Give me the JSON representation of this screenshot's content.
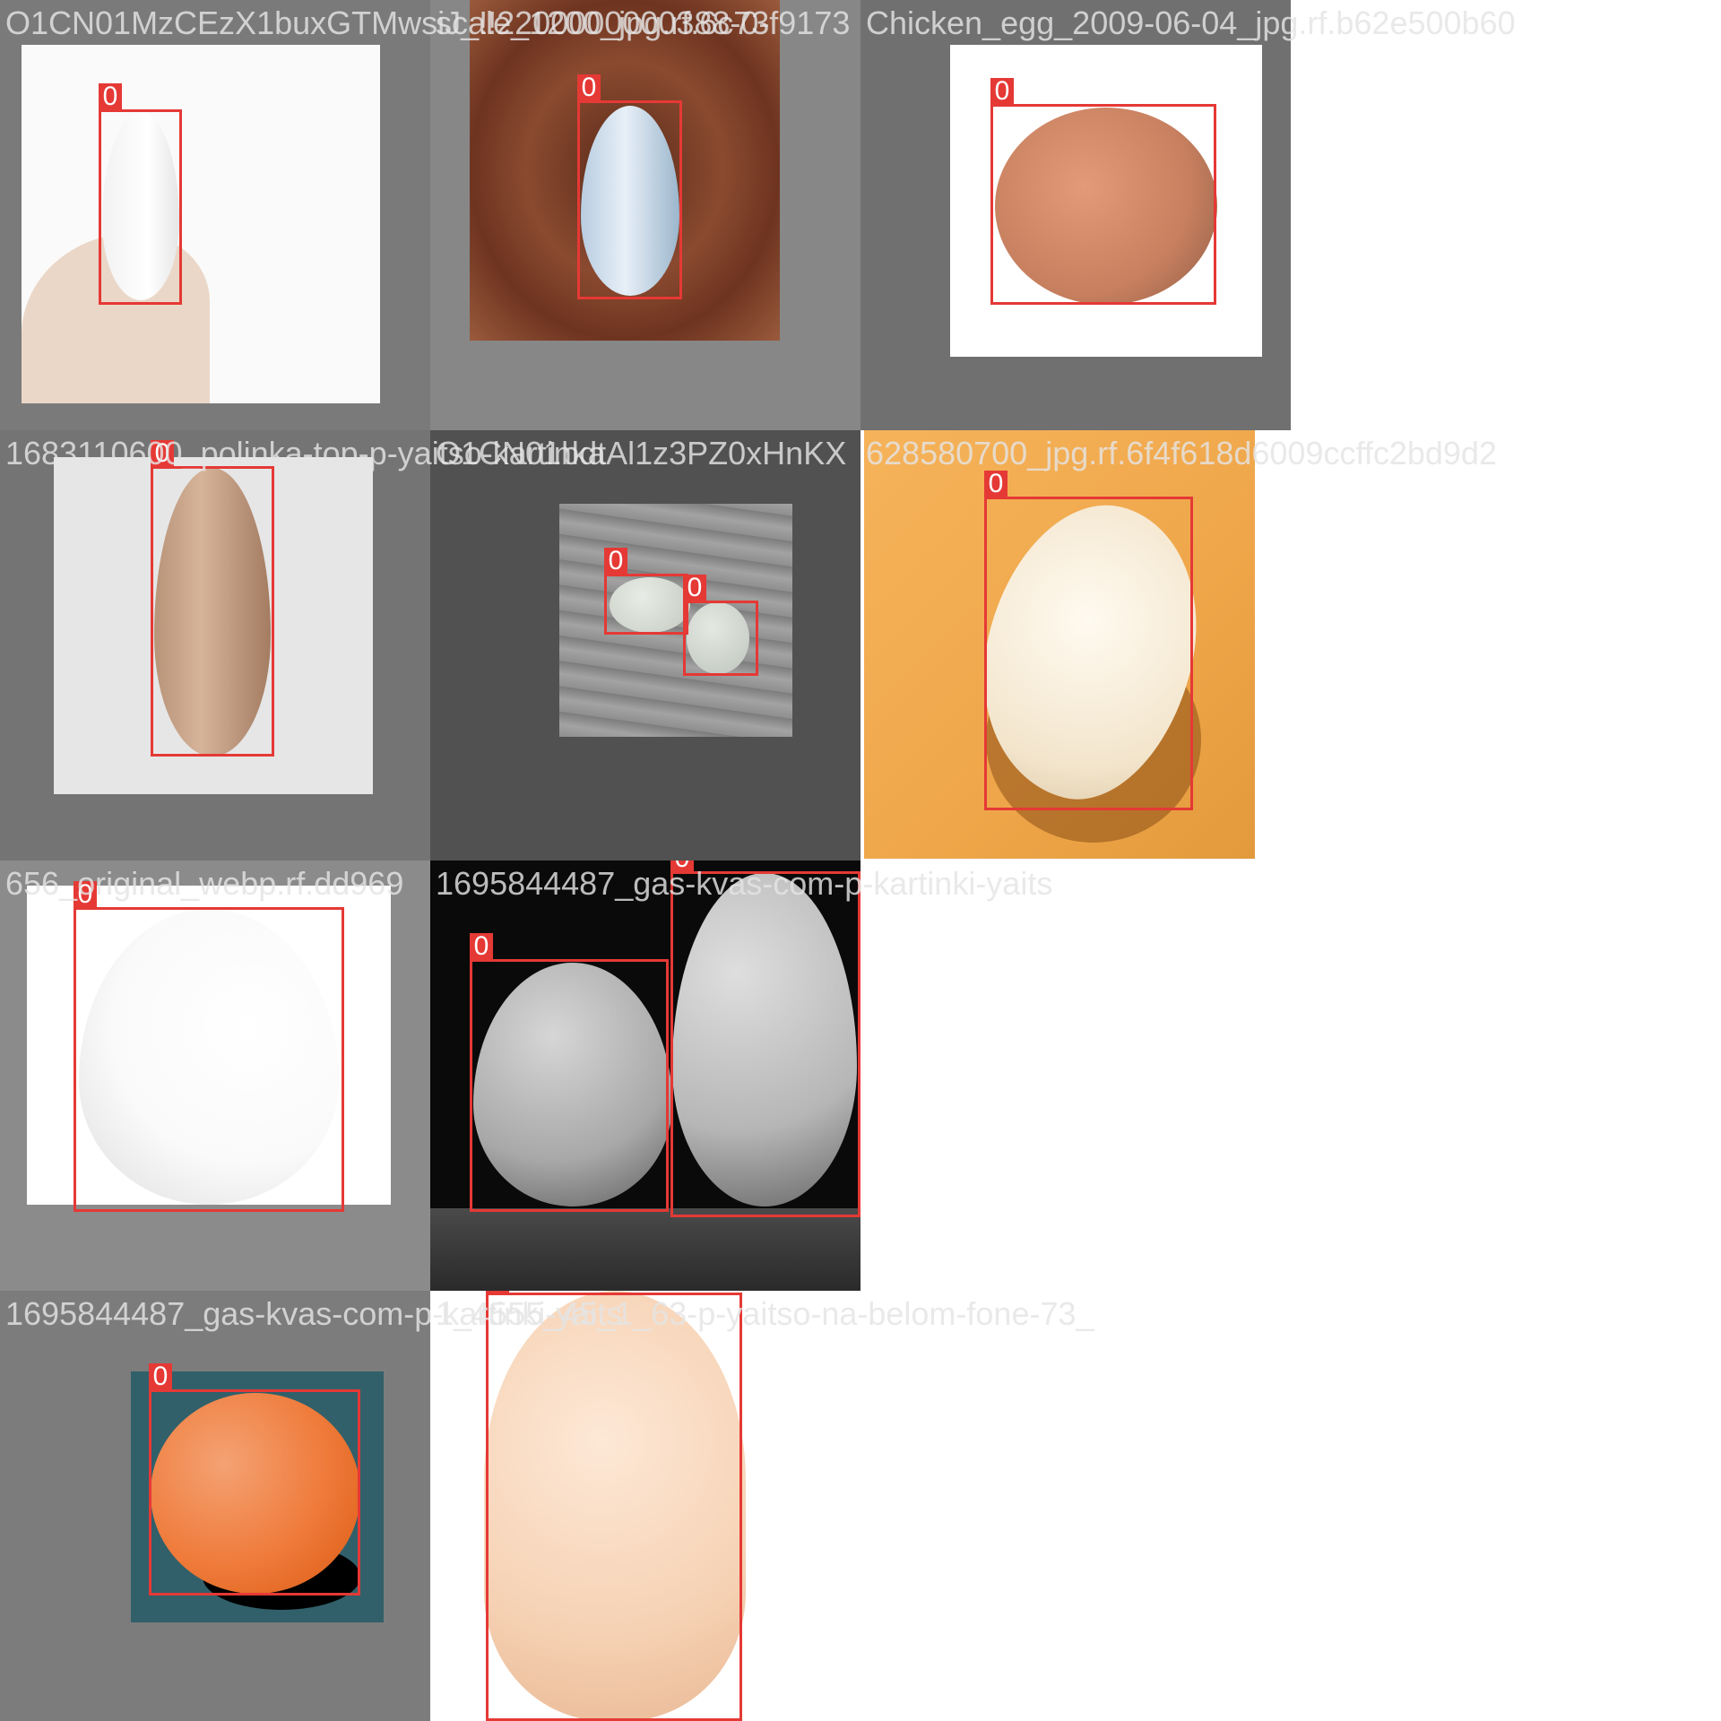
{
  "grid": {
    "captions": [
      "O1CN01MzCEzX1buxGTMwsiJ_!!2200000000388-0-",
      "scale_1200_jpg.rf.6c73f9173",
      "Chicken_egg_2009-06-04_jpg.rf.b62e500b60",
      "1683110600_polinka-top-p-yaitso-kartinka",
      "O1CN01bdtAl1z3PZ0xHnKX",
      "628580700_jpg.rf.6f4f618d6009ccffc2bd9d2",
      "656_original_webp.rf.dd969",
      "1695844487_gas-kvas-com-p-kartinki-yaits",
      "1695844487_gas-kvas-com-p-kartinki-yaits",
      "1_4555_45_1_63-p-yaitso-na-belom-fone-73_"
    ],
    "box_label": "0",
    "box_color": "#e53935"
  }
}
